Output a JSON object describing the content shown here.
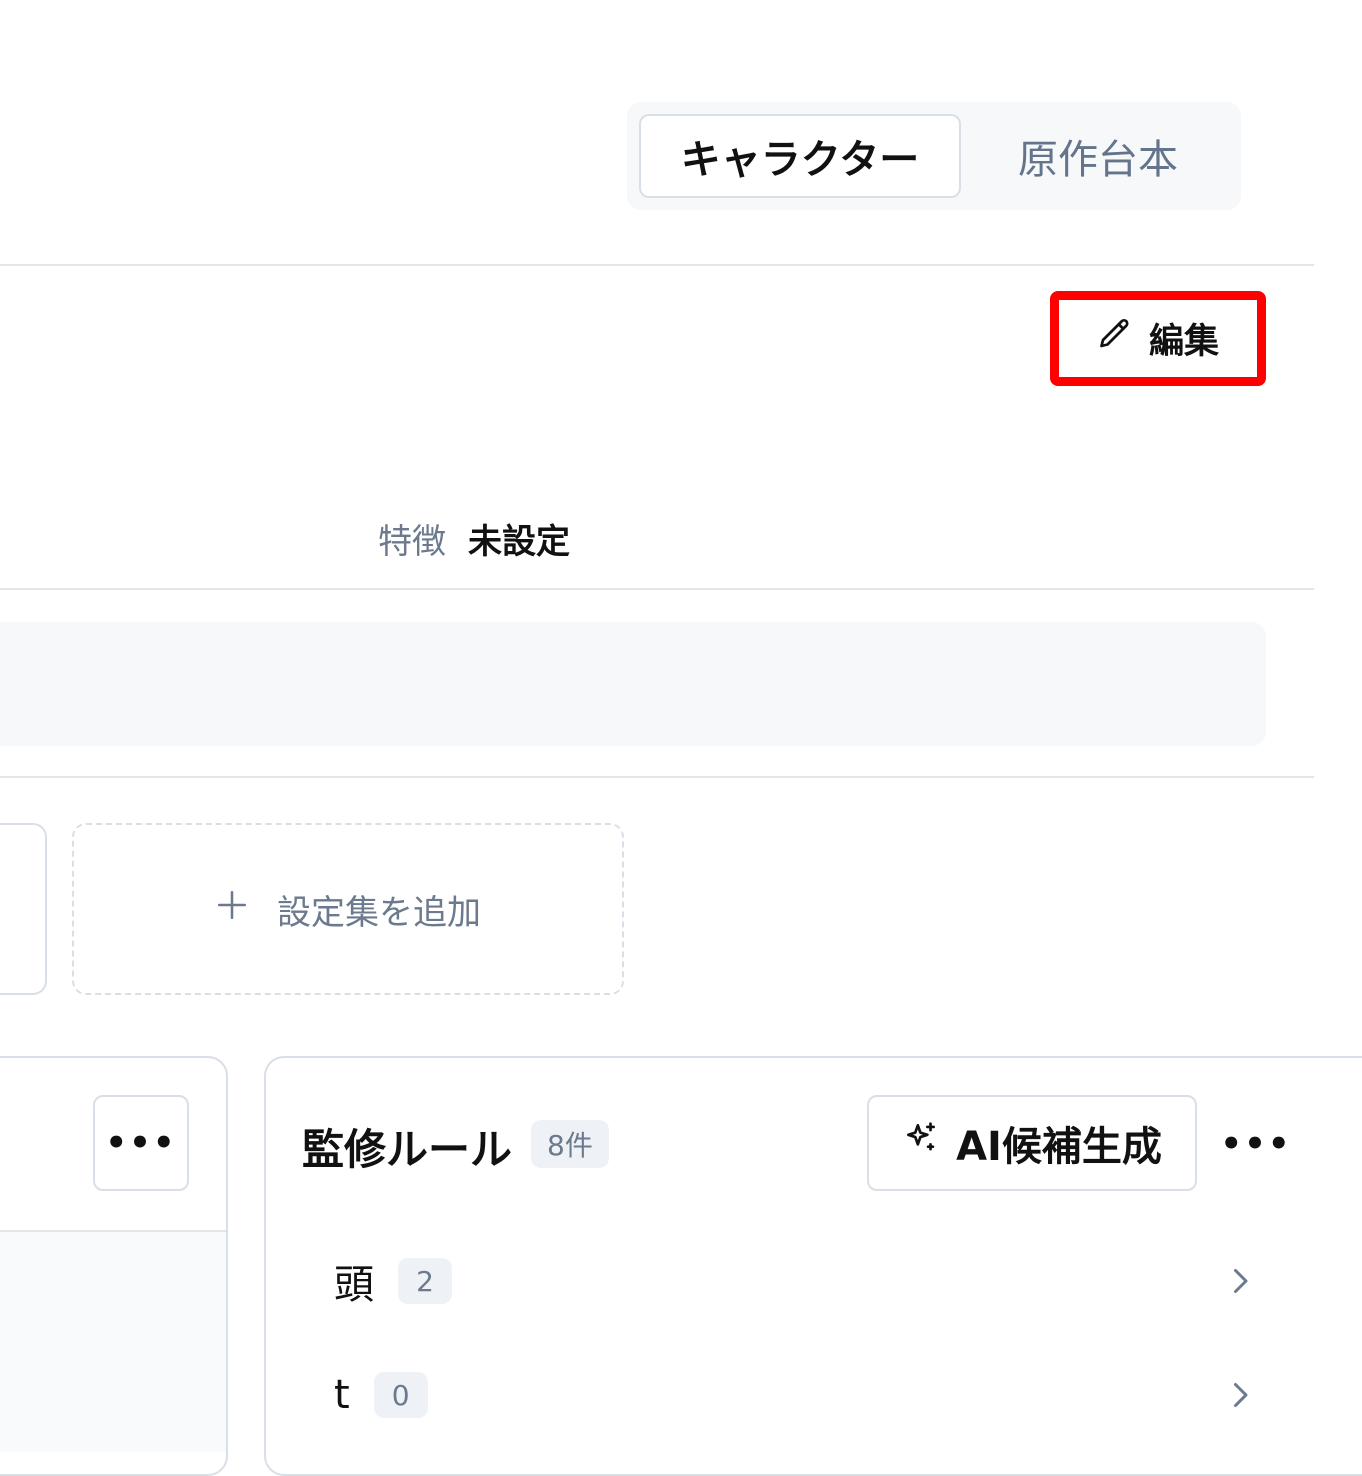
{
  "tabs": [
    {
      "label": "キャラクター",
      "active": true
    },
    {
      "label": "原作台本",
      "active": false
    }
  ],
  "toolbar": {
    "edit_label": "編集",
    "edit_icon": "pencil-icon"
  },
  "feature": {
    "label": "特徴",
    "value": "未設定"
  },
  "settings": {
    "add_label": "設定集を追加",
    "add_icon": "plus-icon"
  },
  "left_panel": {
    "more_label": "•••"
  },
  "rules": {
    "title": "監修ルール",
    "count": "8件",
    "ai_button_label": "AI候補生成",
    "ai_icon": "sparkle-icon",
    "more_label": "•••",
    "items": [
      {
        "name": "頭",
        "count": "2"
      },
      {
        "name": "t",
        "count": "0"
      }
    ]
  },
  "colors": {
    "highlight_border": "#ff0000",
    "muted_text": "#6b7a8d",
    "border": "#d9dfe6",
    "panel_bg": "#f6f8fa"
  }
}
